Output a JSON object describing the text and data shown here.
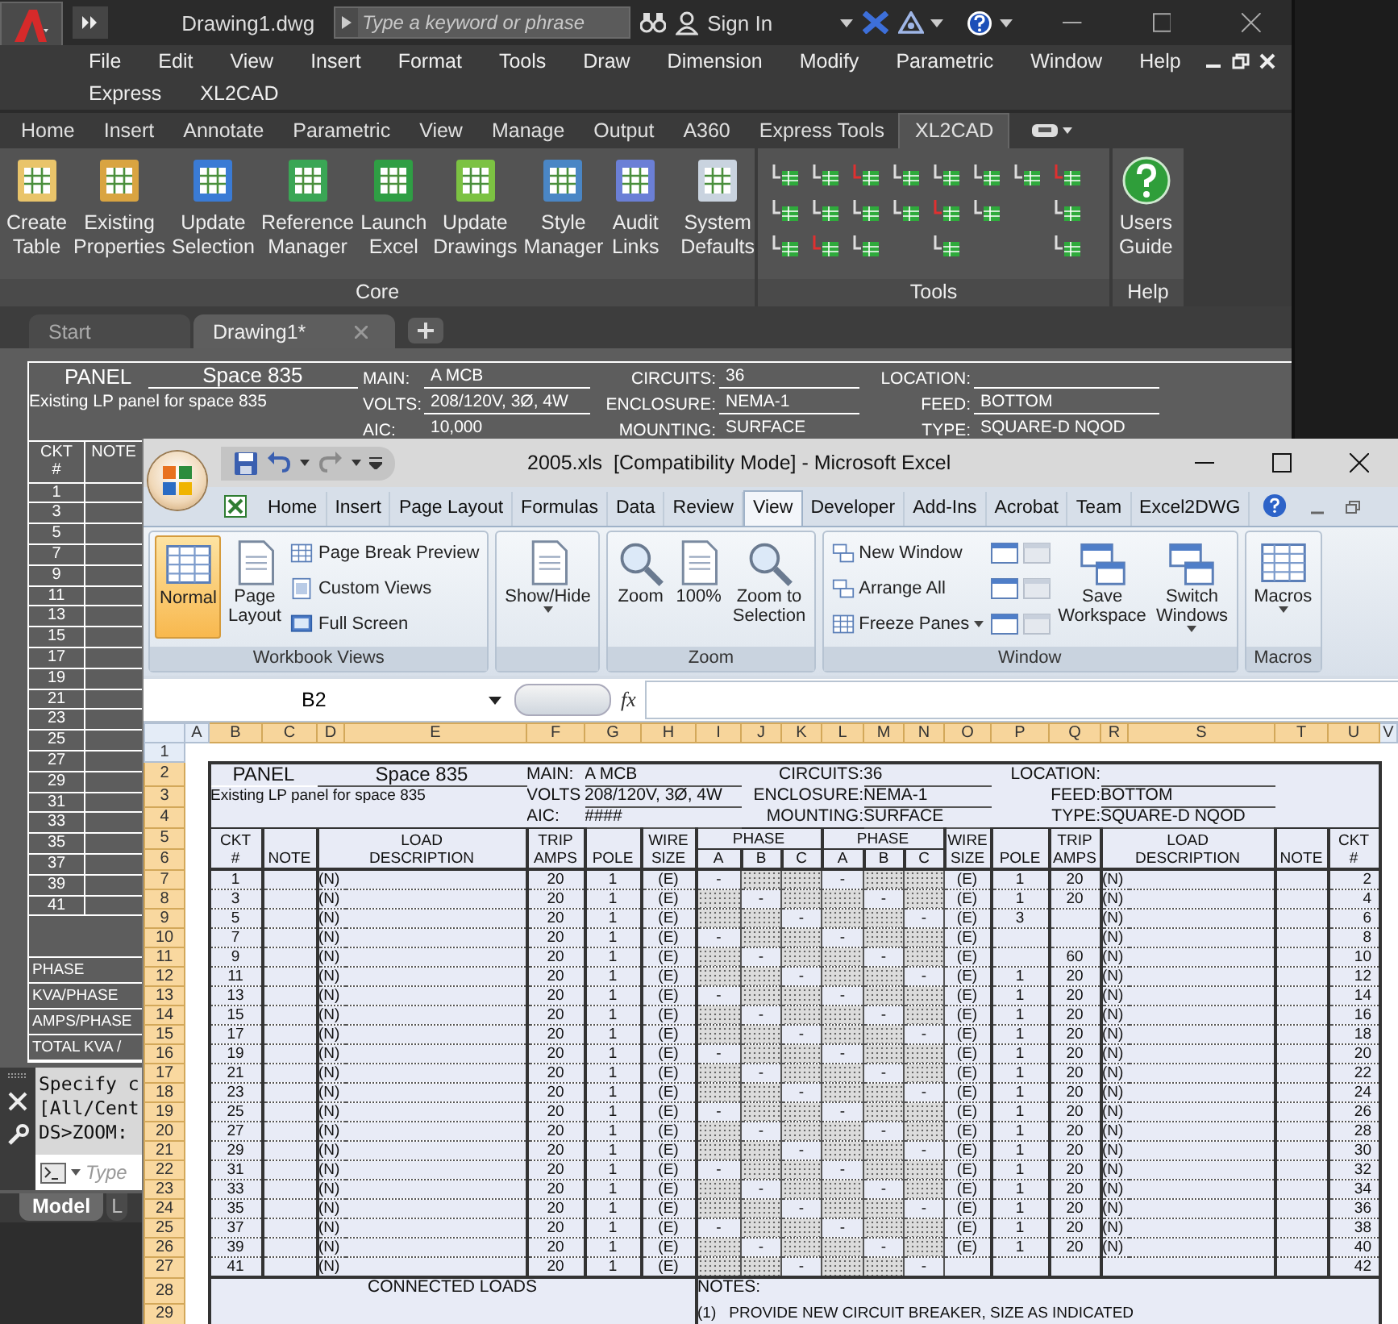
{
  "autocad": {
    "file_name": "Drawing1.dwg",
    "search": {
      "placeholder": "Type a keyword or phrase"
    },
    "sign_in": "Sign In",
    "menu_rows": [
      [
        "File",
        "Edit",
        "View",
        "Insert",
        "Format",
        "Tools",
        "Draw",
        "Dimension",
        "Modify",
        "Parametric",
        "Window",
        "Help"
      ],
      [
        "Express",
        "XL2CAD"
      ]
    ],
    "ribbon_tabs": [
      {
        "label": "Home",
        "selected": false
      },
      {
        "label": "Insert",
        "selected": false
      },
      {
        "label": "Annotate",
        "selected": false
      },
      {
        "label": "Parametric",
        "selected": false
      },
      {
        "label": "View",
        "selected": false
      },
      {
        "label": "Manage",
        "selected": false
      },
      {
        "label": "Output",
        "selected": false
      },
      {
        "label": "A360",
        "selected": false
      },
      {
        "label": "Express Tools",
        "selected": false
      },
      {
        "label": "XL2CAD",
        "selected": true
      }
    ],
    "core_buttons": [
      "Create\nTable",
      "Existing\nProperties",
      "Update\nSelection",
      "Reference\nManager",
      "Launch\nExcel",
      "Update\nDrawings",
      "Style\nManager",
      "Audit\nLinks",
      "System\nDefaults"
    ],
    "help_button": "Users\nGuide",
    "panel_titles": [
      "Core",
      "Tools",
      "Help"
    ],
    "doc_tabs": [
      {
        "label": "Start",
        "selected": false
      },
      {
        "label": "Drawing1*",
        "selected": true
      }
    ],
    "drawing": {
      "header": {
        "title": "PANEL",
        "name": "Space 835",
        "description": "Existing LP panel for space 835",
        "fields": [
          {
            "label": "MAIN:",
            "value": "A MCB"
          },
          {
            "label": "VOLTS:",
            "value": "208/120V, 3Ø, 4W"
          },
          {
            "label": "AIC:",
            "value": "10,000"
          },
          {
            "label": "CIRCUITS:",
            "value": "36"
          },
          {
            "label": "ENCLOSURE:",
            "value": "NEMA-1"
          },
          {
            "label": "MOUNTING:",
            "value": "SURFACE"
          },
          {
            "label": "LOCATION:"
          },
          {
            "label": "FEED:",
            "value": "BOTTOM"
          },
          {
            "label": "TYPE:",
            "value": "SQUARE-D NQOD"
          }
        ]
      },
      "ckt_header": "CKT\n#",
      "note_header": "NOTE",
      "circuits": [
        "1",
        "3",
        "5",
        "7",
        "9",
        "11",
        "13",
        "15",
        "17",
        "19",
        "21",
        "23",
        "25",
        "27",
        "29",
        "31",
        "33",
        "35",
        "37",
        "39",
        "41"
      ],
      "summary_rows": [
        "PHASE",
        "KVA/PHASE",
        "AMPS/PHASE",
        "TOTAL KVA /"
      ]
    },
    "command": {
      "lines": [
        "Specify c",
        "[All/Cent",
        "DS>ZOOM:"
      ],
      "placeholder": "Type"
    },
    "layout_tabs": [
      {
        "label": "Model",
        "selected": true
      },
      {
        "label": "L",
        "selected": false
      }
    ]
  },
  "excel": {
    "title": "2005.xls  [Compatibility Mode] - Microsoft Excel",
    "tabs": [
      {
        "label": "Home",
        "selected": false
      },
      {
        "label": "Insert",
        "selected": false
      },
      {
        "label": "Page Layout",
        "selected": false
      },
      {
        "label": "Formulas",
        "selected": false
      },
      {
        "label": "Data",
        "selected": false
      },
      {
        "label": "Review",
        "selected": false
      },
      {
        "label": "View",
        "selected": true
      },
      {
        "label": "Developer",
        "selected": false
      },
      {
        "label": "Add-Ins",
        "selected": false
      },
      {
        "label": "Acrobat",
        "selected": false
      },
      {
        "label": "Team",
        "selected": false
      },
      {
        "label": "Excel2DWG",
        "selected": false
      }
    ],
    "ribbon_groups": [
      {
        "title": "Workbook Views",
        "buttons": [
          {
            "label": "Normal",
            "kind": "large",
            "selected": true
          },
          {
            "label": "Page\nLayout",
            "kind": "large",
            "selected": false
          },
          {
            "label": "Page Break Preview",
            "kind": "small",
            "selected": false
          },
          {
            "label": "Custom Views",
            "kind": "small",
            "selected": false
          },
          {
            "label": "Full Screen",
            "kind": "small",
            "selected": false
          }
        ]
      },
      {
        "buttons": [
          {
            "label": "Show/Hide",
            "kind": "large",
            "dropdown": true
          }
        ]
      },
      {
        "title": "Zoom",
        "buttons": [
          {
            "label": "Zoom",
            "kind": "large"
          },
          {
            "label": "100%",
            "kind": "large"
          },
          {
            "label": "Zoom to\nSelection",
            "kind": "large"
          }
        ]
      },
      {
        "title": "Window",
        "buttons": [
          {
            "label": "New Window",
            "kind": "small"
          },
          {
            "label": "Arrange All",
            "kind": "small"
          },
          {
            "label": "Freeze Panes",
            "kind": "small",
            "dropdown": true
          },
          {
            "kind": "tool",
            "disabled": false
          },
          {
            "kind": "tool",
            "disabled": false
          },
          {
            "kind": "tool",
            "disabled": false
          },
          {
            "kind": "tool",
            "disabled": true
          },
          {
            "kind": "tool",
            "disabled": true
          },
          {
            "kind": "tool",
            "disabled": true
          },
          {
            "label": "Save\nWorkspace",
            "kind": "large"
          },
          {
            "label": "Switch\nWindows",
            "kind": "large",
            "dropdown": true
          }
        ]
      },
      {
        "title": "Macros",
        "buttons": [
          {
            "label": "Macros",
            "kind": "large",
            "dropdown": true
          }
        ]
      }
    ],
    "name_box": "B2",
    "function_label": "fx",
    "columns": [
      {
        "label": "A",
        "selected": false
      },
      {
        "label": "B",
        "selected": true
      },
      {
        "label": "C",
        "selected": true
      },
      {
        "label": "D",
        "selected": true
      },
      {
        "label": "E",
        "selected": true
      },
      {
        "label": "F",
        "selected": true
      },
      {
        "label": "G",
        "selected": true
      },
      {
        "label": "H",
        "selected": true
      },
      {
        "label": "I",
        "selected": true
      },
      {
        "label": "J",
        "selected": true
      },
      {
        "label": "K",
        "selected": true
      },
      {
        "label": "L",
        "selected": true
      },
      {
        "label": "M",
        "selected": true
      },
      {
        "label": "N",
        "selected": true
      },
      {
        "label": "O",
        "selected": true
      },
      {
        "label": "P",
        "selected": true
      },
      {
        "label": "Q",
        "selected": true
      },
      {
        "label": "R",
        "selected": true
      },
      {
        "label": "S",
        "selected": true
      },
      {
        "label": "T",
        "selected": true
      },
      {
        "label": "U",
        "selected": true
      },
      {
        "label": "V",
        "selected": false
      }
    ],
    "row_headers": [
      {
        "label": "1",
        "selected": false
      },
      {
        "label": "2",
        "selected": true
      },
      {
        "label": "3",
        "selected": true
      },
      {
        "label": "4",
        "selected": true
      },
      {
        "label": "5",
        "selected": true
      },
      {
        "label": "6",
        "selected": true
      },
      {
        "label": "7",
        "selected": true
      },
      {
        "label": "8",
        "selected": true
      },
      {
        "label": "9",
        "selected": true
      },
      {
        "label": "10",
        "selected": true
      },
      {
        "label": "11",
        "selected": true
      },
      {
        "label": "12",
        "selected": true
      },
      {
        "label": "13",
        "selected": true
      },
      {
        "label": "14",
        "selected": true
      },
      {
        "label": "15",
        "selected": true
      },
      {
        "label": "16",
        "selected": true
      },
      {
        "label": "17",
        "selected": true
      },
      {
        "label": "18",
        "selected": true
      },
      {
        "label": "19",
        "selected": true
      },
      {
        "label": "20",
        "selected": true
      },
      {
        "label": "21",
        "selected": true
      },
      {
        "label": "22",
        "selected": true
      },
      {
        "label": "23",
        "selected": true
      },
      {
        "label": "24",
        "selected": true
      },
      {
        "label": "25",
        "selected": true
      },
      {
        "label": "26",
        "selected": true
      },
      {
        "label": "27",
        "selected": true
      },
      {
        "label": "28",
        "selected": true
      },
      {
        "label": "29",
        "selected": true
      }
    ],
    "sheet": {
      "header": {
        "title": "PANEL",
        "name": "Space 835",
        "description": "Existing LP panel for space 835",
        "fields": [
          {
            "label": "MAIN:",
            "value": "A MCB"
          },
          {
            "label": "VOLTS",
            "value": "208/120V, 3Ø, 4W"
          },
          {
            "label": "AIC:",
            "value": "####"
          },
          {
            "label": "CIRCUITS:",
            "value": "36"
          },
          {
            "label": "ENCLOSURE:",
            "value": "NEMA-1"
          },
          {
            "label": "MOUNTING:",
            "value": "SURFACE"
          },
          {
            "label": "LOCATION:"
          },
          {
            "label": "FEED:",
            "value": "BOTTOM"
          },
          {
            "label": "TYPE:",
            "value": "SQUARE-D NQOD"
          }
        ]
      },
      "left_headings": [
        "CKT\n#",
        "NOTE",
        "LOAD\nDESCRIPTION",
        "TRIP\nAMPS",
        "POLE",
        "WIRE\nSIZE"
      ],
      "phase_groups": [
        {
          "label": "PHASE",
          "letters": [
            "A",
            "B",
            "C"
          ]
        },
        {
          "label": "PHASE",
          "letters": [
            "A",
            "B",
            "C"
          ]
        }
      ],
      "right_headings": [
        "WIRE\nSIZE",
        "POLE",
        "TRIP\nAMPS",
        "LOAD\nDESCRIPTION",
        "NOTE",
        "CKT\n#"
      ],
      "rows": [
        {
          "left": {
            "ckt": "1",
            "load": "(N)",
            "trip": "20",
            "pole": "1",
            "wire": "(E)"
          },
          "phases": [
            {
              "text": "-",
              "shaded": false
            },
            {
              "shaded": true
            },
            {
              "shaded": true
            },
            {
              "text": "-",
              "shaded": false
            },
            {
              "shaded": true
            },
            {
              "shaded": true
            }
          ],
          "right": {
            "wire": "(E)",
            "pole": "1",
            "trip": "20",
            "load": "(N)",
            "ckt": "2"
          }
        },
        {
          "left": {
            "ckt": "3",
            "load": "(N)",
            "trip": "20",
            "pole": "1",
            "wire": "(E)"
          },
          "phases": [
            {
              "shaded": true
            },
            {
              "text": "-",
              "shaded": false
            },
            {
              "shaded": true
            },
            {
              "shaded": true
            },
            {
              "text": "-",
              "shaded": false
            },
            {
              "shaded": true
            }
          ],
          "right": {
            "wire": "(E)",
            "pole": "1",
            "trip": "20",
            "load": "(N)",
            "ckt": "4"
          }
        },
        {
          "left": {
            "ckt": "5",
            "load": "(N)",
            "trip": "20",
            "pole": "1",
            "wire": "(E)"
          },
          "phases": [
            {
              "shaded": true
            },
            {
              "shaded": true
            },
            {
              "text": "-",
              "shaded": false
            },
            {
              "shaded": true
            },
            {
              "shaded": true
            },
            {
              "text": "-",
              "shaded": false
            }
          ],
          "right": {
            "wire": "(E)",
            "pole": "3",
            "load": "(N)",
            "ckt": "6"
          }
        },
        {
          "left": {
            "ckt": "7",
            "load": "(N)",
            "trip": "20",
            "pole": "1",
            "wire": "(E)"
          },
          "phases": [
            {
              "text": "-",
              "shaded": false
            },
            {
              "shaded": true
            },
            {
              "shaded": true
            },
            {
              "text": "-",
              "shaded": false
            },
            {
              "shaded": true
            },
            {
              "shaded": true
            }
          ],
          "right": {
            "wire": "(E)",
            "load": "(N)",
            "ckt": "8"
          }
        },
        {
          "left": {
            "ckt": "9",
            "load": "(N)",
            "trip": "20",
            "pole": "1",
            "wire": "(E)"
          },
          "phases": [
            {
              "shaded": true
            },
            {
              "text": "-",
              "shaded": false
            },
            {
              "shaded": true
            },
            {
              "shaded": true
            },
            {
              "text": "-",
              "shaded": false
            },
            {
              "shaded": true
            }
          ],
          "right": {
            "wire": "(E)",
            "trip": "60",
            "load": "(N)",
            "ckt": "10"
          }
        },
        {
          "left": {
            "ckt": "11",
            "load": "(N)",
            "trip": "20",
            "pole": "1",
            "wire": "(E)"
          },
          "phases": [
            {
              "shaded": true
            },
            {
              "shaded": true
            },
            {
              "text": "-",
              "shaded": false
            },
            {
              "shaded": true
            },
            {
              "shaded": true
            },
            {
              "text": "-",
              "shaded": false
            }
          ],
          "right": {
            "wire": "(E)",
            "pole": "1",
            "trip": "20",
            "load": "(N)",
            "ckt": "12"
          }
        },
        {
          "left": {
            "ckt": "13",
            "load": "(N)",
            "trip": "20",
            "pole": "1",
            "wire": "(E)"
          },
          "phases": [
            {
              "text": "-",
              "shaded": false
            },
            {
              "shaded": true
            },
            {
              "shaded": true
            },
            {
              "text": "-",
              "shaded": false
            },
            {
              "shaded": true
            },
            {
              "shaded": true
            }
          ],
          "right": {
            "wire": "(E)",
            "pole": "1",
            "trip": "20",
            "load": "(N)",
            "ckt": "14"
          }
        },
        {
          "left": {
            "ckt": "15",
            "load": "(N)",
            "trip": "20",
            "pole": "1",
            "wire": "(E)"
          },
          "phases": [
            {
              "shaded": true
            },
            {
              "text": "-",
              "shaded": false
            },
            {
              "shaded": true
            },
            {
              "shaded": true
            },
            {
              "text": "-",
              "shaded": false
            },
            {
              "shaded": true
            }
          ],
          "right": {
            "wire": "(E)",
            "pole": "1",
            "trip": "20",
            "load": "(N)",
            "ckt": "16"
          }
        },
        {
          "left": {
            "ckt": "17",
            "load": "(N)",
            "trip": "20",
            "pole": "1",
            "wire": "(E)"
          },
          "phases": [
            {
              "shaded": true
            },
            {
              "shaded": true
            },
            {
              "text": "-",
              "shaded": false
            },
            {
              "shaded": true
            },
            {
              "shaded": true
            },
            {
              "text": "-",
              "shaded": false
            }
          ],
          "right": {
            "wire": "(E)",
            "pole": "1",
            "trip": "20",
            "load": "(N)",
            "ckt": "18"
          }
        },
        {
          "left": {
            "ckt": "19",
            "load": "(N)",
            "trip": "20",
            "pole": "1",
            "wire": "(E)"
          },
          "phases": [
            {
              "text": "-",
              "shaded": false
            },
            {
              "shaded": true
            },
            {
              "shaded": true
            },
            {
              "text": "-",
              "shaded": false
            },
            {
              "shaded": true
            },
            {
              "shaded": true
            }
          ],
          "right": {
            "wire": "(E)",
            "pole": "1",
            "trip": "20",
            "load": "(N)",
            "ckt": "20"
          }
        },
        {
          "left": {
            "ckt": "21",
            "load": "(N)",
            "trip": "20",
            "pole": "1",
            "wire": "(E)"
          },
          "phases": [
            {
              "shaded": true
            },
            {
              "text": "-",
              "shaded": false
            },
            {
              "shaded": true
            },
            {
              "shaded": true
            },
            {
              "text": "-",
              "shaded": false
            },
            {
              "shaded": true
            }
          ],
          "right": {
            "wire": "(E)",
            "pole": "1",
            "trip": "20",
            "load": "(N)",
            "ckt": "22"
          }
        },
        {
          "left": {
            "ckt": "23",
            "load": "(N)",
            "trip": "20",
            "pole": "1",
            "wire": "(E)"
          },
          "phases": [
            {
              "shaded": true
            },
            {
              "shaded": true
            },
            {
              "text": "-",
              "shaded": false
            },
            {
              "shaded": true
            },
            {
              "shaded": true
            },
            {
              "text": "-",
              "shaded": false
            }
          ],
          "right": {
            "wire": "(E)",
            "pole": "1",
            "trip": "20",
            "load": "(N)",
            "ckt": "24"
          }
        },
        {
          "left": {
            "ckt": "25",
            "load": "(N)",
            "trip": "20",
            "pole": "1",
            "wire": "(E)"
          },
          "phases": [
            {
              "text": "-",
              "shaded": false
            },
            {
              "shaded": true
            },
            {
              "shaded": true
            },
            {
              "text": "-",
              "shaded": false
            },
            {
              "shaded": true
            },
            {
              "shaded": true
            }
          ],
          "right": {
            "wire": "(E)",
            "pole": "1",
            "trip": "20",
            "load": "(N)",
            "ckt": "26"
          }
        },
        {
          "left": {
            "ckt": "27",
            "load": "(N)",
            "trip": "20",
            "pole": "1",
            "wire": "(E)"
          },
          "phases": [
            {
              "shaded": true
            },
            {
              "text": "-",
              "shaded": false
            },
            {
              "shaded": true
            },
            {
              "shaded": true
            },
            {
              "text": "-",
              "shaded": false
            },
            {
              "shaded": true
            }
          ],
          "right": {
            "wire": "(E)",
            "pole": "1",
            "trip": "20",
            "load": "(N)",
            "ckt": "28"
          }
        },
        {
          "left": {
            "ckt": "29",
            "load": "(N)",
            "trip": "20",
            "pole": "1",
            "wire": "(E)"
          },
          "phases": [
            {
              "shaded": true
            },
            {
              "shaded": true
            },
            {
              "text": "-",
              "shaded": false
            },
            {
              "shaded": true
            },
            {
              "shaded": true
            },
            {
              "text": "-",
              "shaded": false
            }
          ],
          "right": {
            "wire": "(E)",
            "pole": "1",
            "trip": "20",
            "load": "(N)",
            "ckt": "30"
          }
        },
        {
          "left": {
            "ckt": "31",
            "load": "(N)",
            "trip": "20",
            "pole": "1",
            "wire": "(E)"
          },
          "phases": [
            {
              "text": "-",
              "shaded": false
            },
            {
              "shaded": true
            },
            {
              "shaded": true
            },
            {
              "text": "-",
              "shaded": false
            },
            {
              "shaded": true
            },
            {
              "shaded": true
            }
          ],
          "right": {
            "wire": "(E)",
            "pole": "1",
            "trip": "20",
            "load": "(N)",
            "ckt": "32"
          }
        },
        {
          "left": {
            "ckt": "33",
            "load": "(N)",
            "trip": "20",
            "pole": "1",
            "wire": "(E)"
          },
          "phases": [
            {
              "shaded": true
            },
            {
              "text": "-",
              "shaded": false
            },
            {
              "shaded": true
            },
            {
              "shaded": true
            },
            {
              "text": "-",
              "shaded": false
            },
            {
              "shaded": true
            }
          ],
          "right": {
            "wire": "(E)",
            "pole": "1",
            "trip": "20",
            "load": "(N)",
            "ckt": "34"
          }
        },
        {
          "left": {
            "ckt": "35",
            "load": "(N)",
            "trip": "20",
            "pole": "1",
            "wire": "(E)"
          },
          "phases": [
            {
              "shaded": true
            },
            {
              "shaded": true
            },
            {
              "text": "-",
              "shaded": false
            },
            {
              "shaded": true
            },
            {
              "shaded": true
            },
            {
              "text": "-",
              "shaded": false
            }
          ],
          "right": {
            "wire": "(E)",
            "pole": "1",
            "trip": "20",
            "load": "(N)",
            "ckt": "36"
          }
        },
        {
          "left": {
            "ckt": "37",
            "load": "(N)",
            "trip": "20",
            "pole": "1",
            "wire": "(E)"
          },
          "phases": [
            {
              "text": "-",
              "shaded": false
            },
            {
              "shaded": true
            },
            {
              "shaded": true
            },
            {
              "text": "-",
              "shaded": false
            },
            {
              "shaded": true
            },
            {
              "shaded": true
            }
          ],
          "right": {
            "wire": "(E)",
            "pole": "1",
            "trip": "20",
            "load": "(N)",
            "ckt": "38"
          }
        },
        {
          "left": {
            "ckt": "39",
            "load": "(N)",
            "trip": "20",
            "pole": "1",
            "wire": "(E)"
          },
          "phases": [
            {
              "shaded": true
            },
            {
              "text": "-",
              "shaded": false
            },
            {
              "shaded": true
            },
            {
              "shaded": true
            },
            {
              "text": "-",
              "shaded": false
            },
            {
              "shaded": true
            }
          ],
          "right": {
            "wire": "(E)",
            "pole": "1",
            "trip": "20",
            "load": "(N)",
            "ckt": "40"
          }
        },
        {
          "left": {
            "ckt": "41",
            "load": "(N)",
            "trip": "20",
            "pole": "1",
            "wire": "(E)"
          },
          "phases": [
            {
              "shaded": true
            },
            {
              "shaded": true
            },
            {
              "text": "-",
              "shaded": false
            },
            {
              "shaded": true
            },
            {
              "shaded": true
            },
            {
              "text": "-",
              "shaded": false
            }
          ],
          "right": {
            "ckt": "42"
          }
        }
      ],
      "connected_loads": "CONNECTED LOADS",
      "notes_title": "NOTES:",
      "notes": [
        {
          "number": "(1)",
          "text": "PROVIDE NEW CIRCUIT BREAKER, SIZE AS INDICATED"
        }
      ]
    }
  }
}
